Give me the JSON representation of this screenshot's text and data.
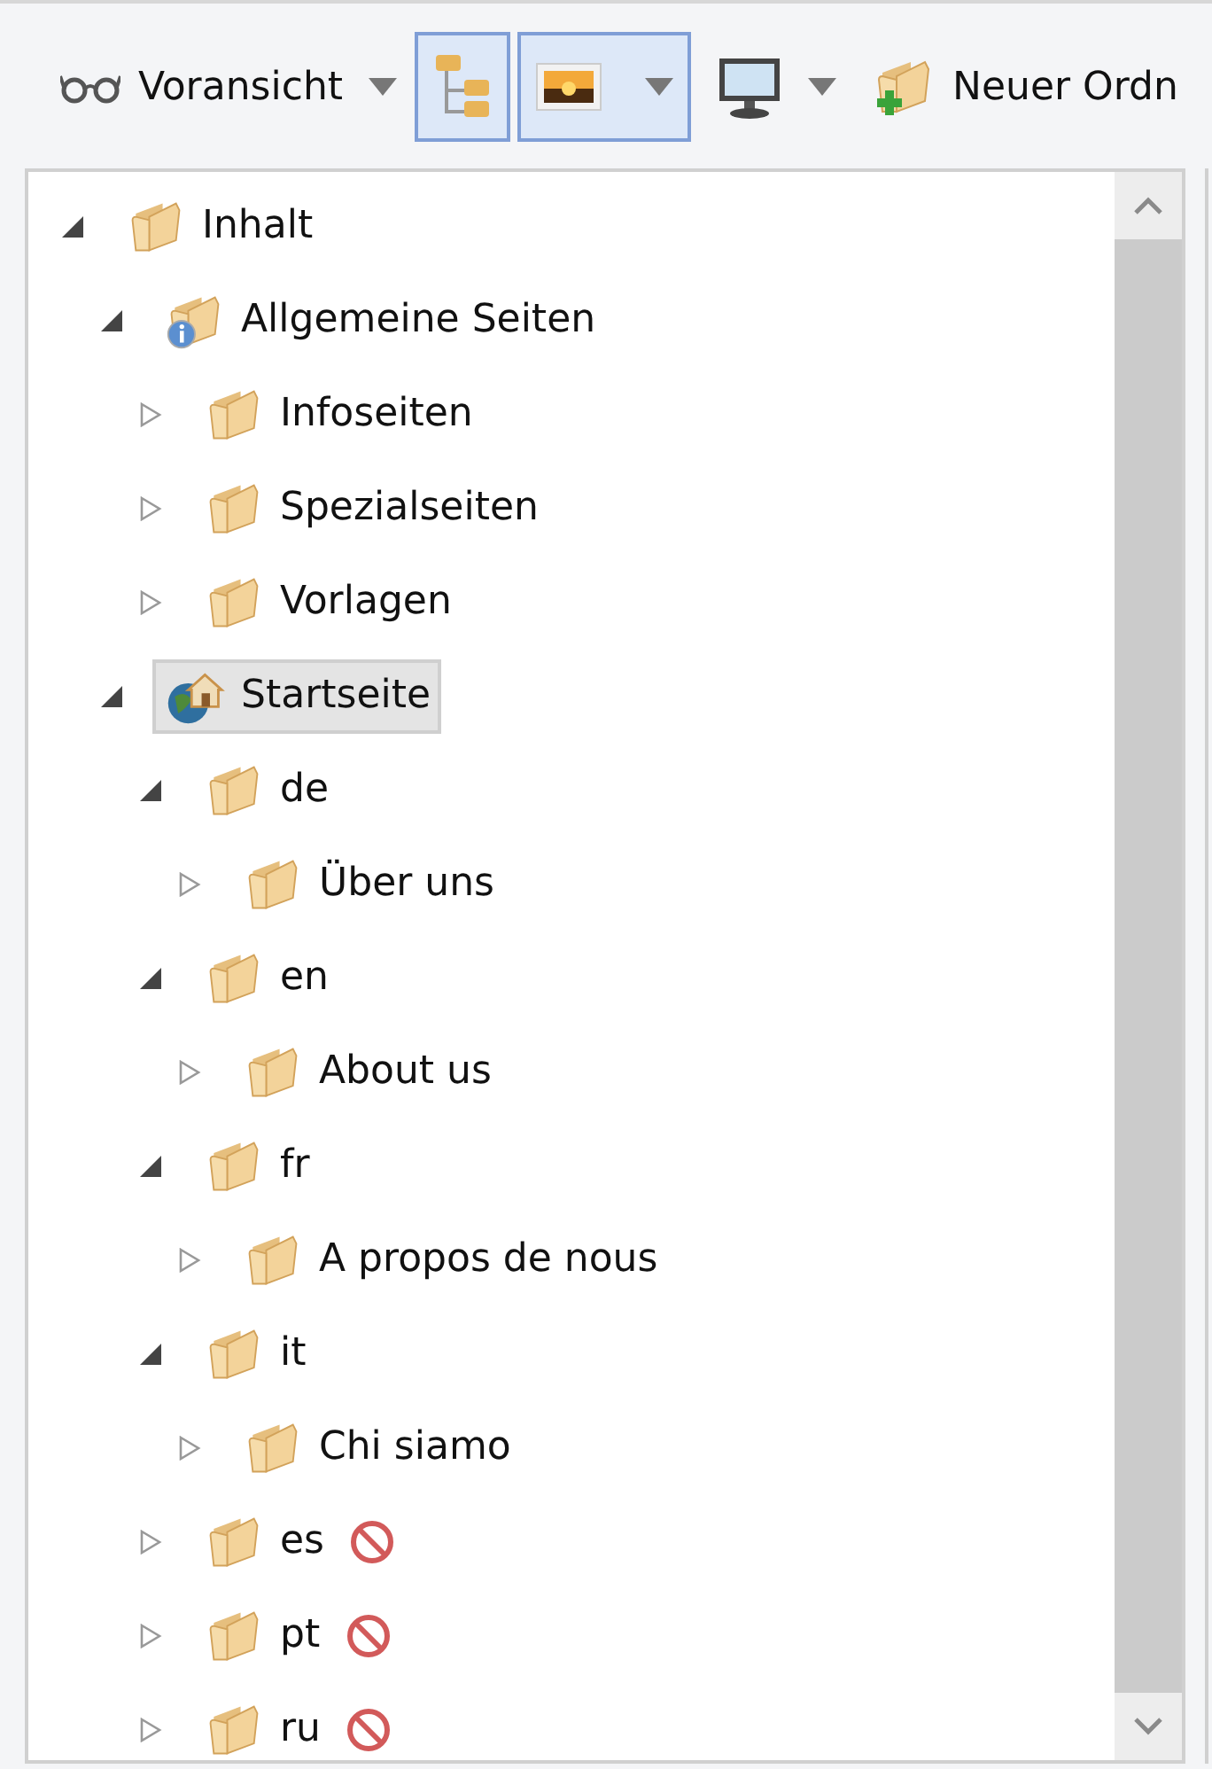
{
  "toolbar": [
    {
      "kind": "preview",
      "label": "Voransicht",
      "pressed": false,
      "dropdown": true
    },
    {
      "kind": "tree",
      "pressed": true,
      "dropdown": false
    },
    {
      "kind": "image",
      "pressed": true,
      "dropdown": true
    },
    {
      "kind": "monitor",
      "pressed": false,
      "dropdown": true
    },
    {
      "kind": "new-folder",
      "label": "Neuer Ordn",
      "pressed": false,
      "dropdown": false
    }
  ],
  "tree": [
    {
      "label": "Inhalt",
      "kind": "folder",
      "expanded": true,
      "selected": false,
      "blocked": false,
      "children": [
        {
          "label": "Allgemeine Seiten",
          "kind": "info-folder",
          "expanded": true,
          "selected": false,
          "blocked": false,
          "children": [
            {
              "label": "Infoseiten",
              "kind": "folder",
              "expanded": false,
              "selected": false,
              "blocked": false
            },
            {
              "label": "Spezialseiten",
              "kind": "folder",
              "expanded": false,
              "selected": false,
              "blocked": false
            },
            {
              "label": "Vorlagen",
              "kind": "folder",
              "expanded": false,
              "selected": false,
              "blocked": false
            }
          ]
        },
        {
          "label": "Startseite",
          "kind": "home-globe",
          "expanded": true,
          "selected": true,
          "blocked": false,
          "children": [
            {
              "label": "de",
              "kind": "folder",
              "expanded": true,
              "selected": false,
              "blocked": false,
              "children": [
                {
                  "label": "Über uns",
                  "kind": "folder",
                  "expanded": false,
                  "selected": false,
                  "blocked": false
                }
              ]
            },
            {
              "label": "en",
              "kind": "folder",
              "expanded": true,
              "selected": false,
              "blocked": false,
              "children": [
                {
                  "label": "About us",
                  "kind": "folder",
                  "expanded": false,
                  "selected": false,
                  "blocked": false
                }
              ]
            },
            {
              "label": "fr",
              "kind": "folder",
              "expanded": true,
              "selected": false,
              "blocked": false,
              "children": [
                {
                  "label": "A propos de nous",
                  "kind": "folder",
                  "expanded": false,
                  "selected": false,
                  "blocked": false
                }
              ]
            },
            {
              "label": "it",
              "kind": "folder",
              "expanded": true,
              "selected": false,
              "blocked": false,
              "children": [
                {
                  "label": "Chi siamo",
                  "kind": "folder",
                  "expanded": false,
                  "selected": false,
                  "blocked": false
                }
              ]
            },
            {
              "label": "es",
              "kind": "folder",
              "expanded": false,
              "selected": false,
              "blocked": true
            },
            {
              "label": "pt",
              "kind": "folder",
              "expanded": false,
              "selected": false,
              "blocked": true
            },
            {
              "label": "ru",
              "kind": "folder",
              "expanded": false,
              "selected": false,
              "blocked": true
            }
          ]
        }
      ]
    }
  ]
}
